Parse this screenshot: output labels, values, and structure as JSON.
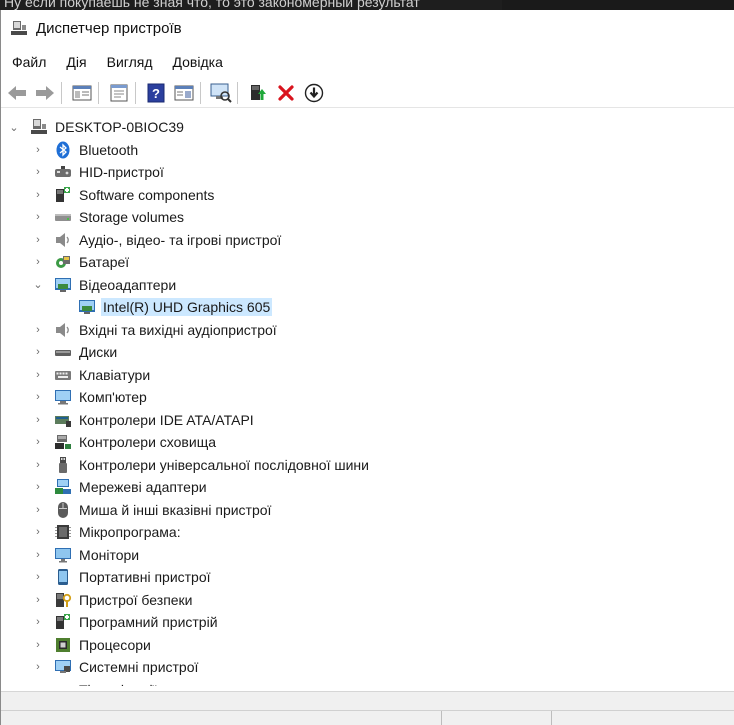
{
  "background_window": {
    "title_fragment": "Ну если покупаешь не зная что, то это закономерный результат"
  },
  "window": {
    "title": "Диспетчер пристроїв"
  },
  "menu": {
    "items": [
      "Файл",
      "Дія",
      "Вигляд",
      "Довідка"
    ]
  },
  "toolbar": {
    "buttons": [
      {
        "icon": "back-arrow-icon"
      },
      {
        "icon": "forward-arrow-icon"
      },
      {
        "icon": "properties-view-icon"
      },
      {
        "icon": "properties-sheet-icon"
      },
      {
        "icon": "help-icon"
      },
      {
        "icon": "resource-view-icon"
      },
      {
        "icon": "scan-hardware-icon"
      },
      {
        "icon": "update-driver-icon"
      },
      {
        "icon": "uninstall-device-icon"
      },
      {
        "icon": "disable-device-icon"
      }
    ]
  },
  "tree": {
    "root": "DESKTOP-0BIOC39",
    "categories": [
      {
        "label": "Bluetooth",
        "icon": "bluetooth-icon",
        "expanded": false
      },
      {
        "label": "HID-пристрої",
        "icon": "hid-device-icon",
        "expanded": false
      },
      {
        "label": "Software components",
        "icon": "software-component-icon",
        "expanded": false
      },
      {
        "label": "Storage volumes",
        "icon": "storage-volume-icon",
        "expanded": false
      },
      {
        "label": "Аудіо-, відео- та ігрові пристрої",
        "icon": "speaker-icon",
        "expanded": false
      },
      {
        "label": "Батареї",
        "icon": "battery-icon",
        "expanded": false
      },
      {
        "label": "Відеоадаптери",
        "icon": "display-adapter-icon",
        "expanded": true,
        "children": [
          "Intel(R) UHD Graphics 605"
        ]
      },
      {
        "label": "Вхідні та вихідні аудіопристрої",
        "icon": "speaker-icon",
        "expanded": false
      },
      {
        "label": "Диски",
        "icon": "disk-drive-icon",
        "expanded": false
      },
      {
        "label": "Клавіатури",
        "icon": "keyboard-icon",
        "expanded": false
      },
      {
        "label": "Комп'ютер",
        "icon": "computer-icon",
        "expanded": false
      },
      {
        "label": "Контролери IDE ATA/ATAPI",
        "icon": "ide-controller-icon",
        "expanded": false
      },
      {
        "label": "Контролери сховища",
        "icon": "storage-controller-icon",
        "expanded": false
      },
      {
        "label": "Контролери універсальної послідовної шини",
        "icon": "usb-icon",
        "expanded": false
      },
      {
        "label": "Мережеві адаптери",
        "icon": "network-adapter-icon",
        "expanded": false
      },
      {
        "label": "Миша й інші вказівні пристрої",
        "icon": "mouse-icon",
        "expanded": false
      },
      {
        "label": "Мікропрограма:",
        "icon": "firmware-icon",
        "expanded": false
      },
      {
        "label": "Монітори",
        "icon": "monitor-icon",
        "expanded": false
      },
      {
        "label": "Портативні пристрої",
        "icon": "portable-device-icon",
        "expanded": false
      },
      {
        "label": "Пристрої безпеки",
        "icon": "security-device-icon",
        "expanded": false
      },
      {
        "label": "Програмний пристрій",
        "icon": "software-device-icon",
        "expanded": false
      },
      {
        "label": "Процесори",
        "icon": "processor-icon",
        "expanded": false
      },
      {
        "label": "Системні пристрої",
        "icon": "system-device-icon",
        "expanded": false
      },
      {
        "label": "Тіньові копії тому сховища",
        "icon": "volume-shadow-copy-icon",
        "expanded": false
      }
    ]
  },
  "colors": {
    "selection": "#cce8ff",
    "accent": "#0078d7"
  }
}
